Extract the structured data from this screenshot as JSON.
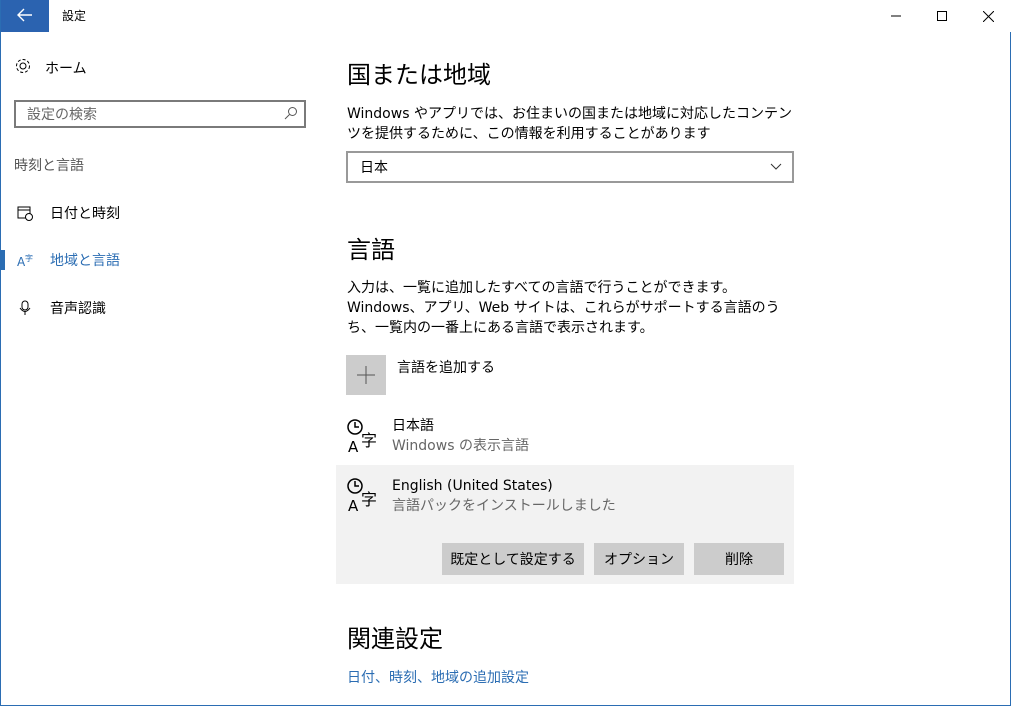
{
  "window": {
    "title": "設定"
  },
  "sidebar": {
    "home_label": "ホーム",
    "search_placeholder": "設定の検索",
    "section_label": "時刻と言語",
    "items": [
      {
        "label": "日付と時刻",
        "icon": "calendar-clock-icon"
      },
      {
        "label": "地域と言語",
        "icon": "region-language-icon",
        "active": true
      },
      {
        "label": "音声認識",
        "icon": "microphone-icon"
      }
    ]
  },
  "region": {
    "heading": "国または地域",
    "description": "Windows やアプリでは、お住まいの国または地域に対応したコンテンツを提供するために、この情報を利用することがあります",
    "selected": "日本"
  },
  "language": {
    "heading": "言語",
    "description": "入力は、一覧に追加したすべての言語で行うことができます。Windows、アプリ、Web サイトは、これらがサポートする言語のうち、一覧内の一番上にある言語で表示されます。",
    "add_label": "言語を追加する",
    "items": [
      {
        "name": "日本語",
        "status": "Windows の表示言語"
      },
      {
        "name": "English (United States)",
        "status": "言語パックをインストールしました"
      }
    ],
    "buttons": {
      "set_default": "既定として設定する",
      "options": "オプション",
      "remove": "削除"
    }
  },
  "related": {
    "heading": "関連設定",
    "link": "日付、時刻、地域の追加設定"
  },
  "colors": {
    "accent": "#2b6db3",
    "button_bg": "#cccccc",
    "selected_bg": "#f2f2f2"
  }
}
